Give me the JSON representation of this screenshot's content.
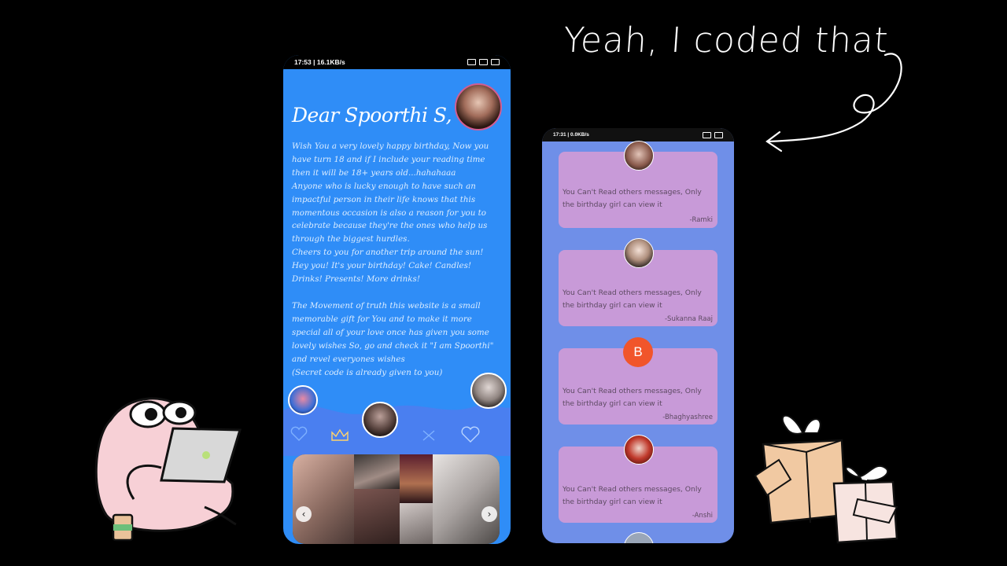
{
  "caption": "Yeah, I coded that",
  "phone1": {
    "status_time": "17:53 | 16.1KB/s",
    "title": "Dear Spoorthi S,",
    "letter": [
      "Wish You a very lovely happy birthday, Now you have turn 18 and if I include your reading time then it will be 18+ years old...hahahaaa",
      "Anyone who is lucky enough to have such an impactful person in their life knows that this momentous occasion is also a reason for you to celebrate because they're the ones who help us through the biggest hurdles.",
      "Cheers to you for another trip around the sun!",
      "Hey you! It's your birthday! Cake! Candles! Drinks! Presents! More drinks!",
      "The Movement of truth this website is a small memorable gift for You and to make it more special all of your love once has given you some lovely wishes So, go and check it \"I am Spoorthi\" and revel everyones wishes",
      "(Secret code is already given to you)"
    ],
    "gallery_prev": "‹",
    "gallery_next": "›"
  },
  "phone2": {
    "status_time": "17:31 | 0.0KB/s",
    "messages": [
      {
        "text": "You Can't Read others messages, Only the birthday girl can view it",
        "signature": "-Ramki"
      },
      {
        "text": "You Can't Read others messages, Only the birthday girl can view it",
        "signature": "-Sukanna Raaj"
      },
      {
        "text": "You Can't Read others messages, Only the birthday girl can view it",
        "signature": "-Bhaghyashree",
        "initial": "B"
      },
      {
        "text": "You Can't Read others messages, Only the birthday girl can view it",
        "signature": "-Anshi"
      }
    ]
  },
  "colors": {
    "background": "#000000",
    "phone1_bg": "#2f8df7",
    "phone2_bg": "#6f8fe8",
    "card": "#c89ad8",
    "initial_avatar": "#f1552a"
  }
}
